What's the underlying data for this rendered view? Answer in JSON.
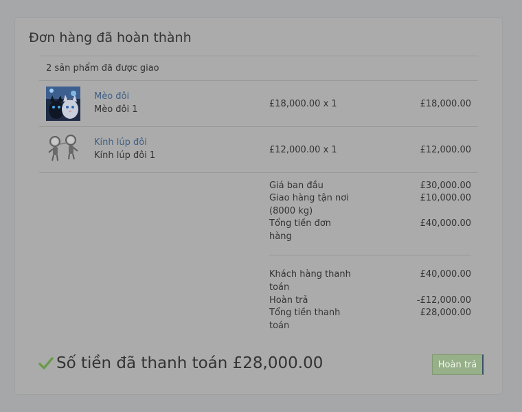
{
  "order": {
    "title": "Đơn hàng đã hoàn thành",
    "shipped_text": "2 sản phẩm đã được giao",
    "items": [
      {
        "name": "Mèo đôi",
        "variant": "Mèo đôi 1",
        "qty_text": "£18,000.00 x 1",
        "total": "£18,000.00",
        "thumbnail": "cats-photo"
      },
      {
        "name": "Kính lúp đôi",
        "variant": "Kính lúp đôi 1",
        "qty_text": "£12,000.00 x 1",
        "total": "£12,000.00",
        "thumbnail": "magnifying-glass-figures"
      }
    ],
    "summary": {
      "subtotal_label": "Giá ban đầu",
      "subtotal_value": "£30,000.00",
      "shipping_label": "Giao hàng tận nơi (8000 kg)",
      "shipping_value": "£10,000.00",
      "total_label": "Tổng tiền đơn hàng",
      "total_value": "£40,000.00",
      "customer_paid_label": "Khách hàng thanh toán",
      "customer_paid_value": "£40,000.00",
      "refund_label": "Hoàn trả",
      "refund_value": "-£12,000.00",
      "net_label": "Tổng tiền thanh toán",
      "net_value": "£28,000.00"
    },
    "paid_status": "Số tiền đã thanh toán £28,000.00",
    "refund_button_label": "Hoàn trả"
  },
  "colors": {
    "page_background": "#a6a7a9",
    "panel_background": "#ababab",
    "link": "#3f5f84",
    "check": "#6c9a4b",
    "refund_button": "#97b089"
  },
  "icons": {
    "status": "check-icon"
  }
}
